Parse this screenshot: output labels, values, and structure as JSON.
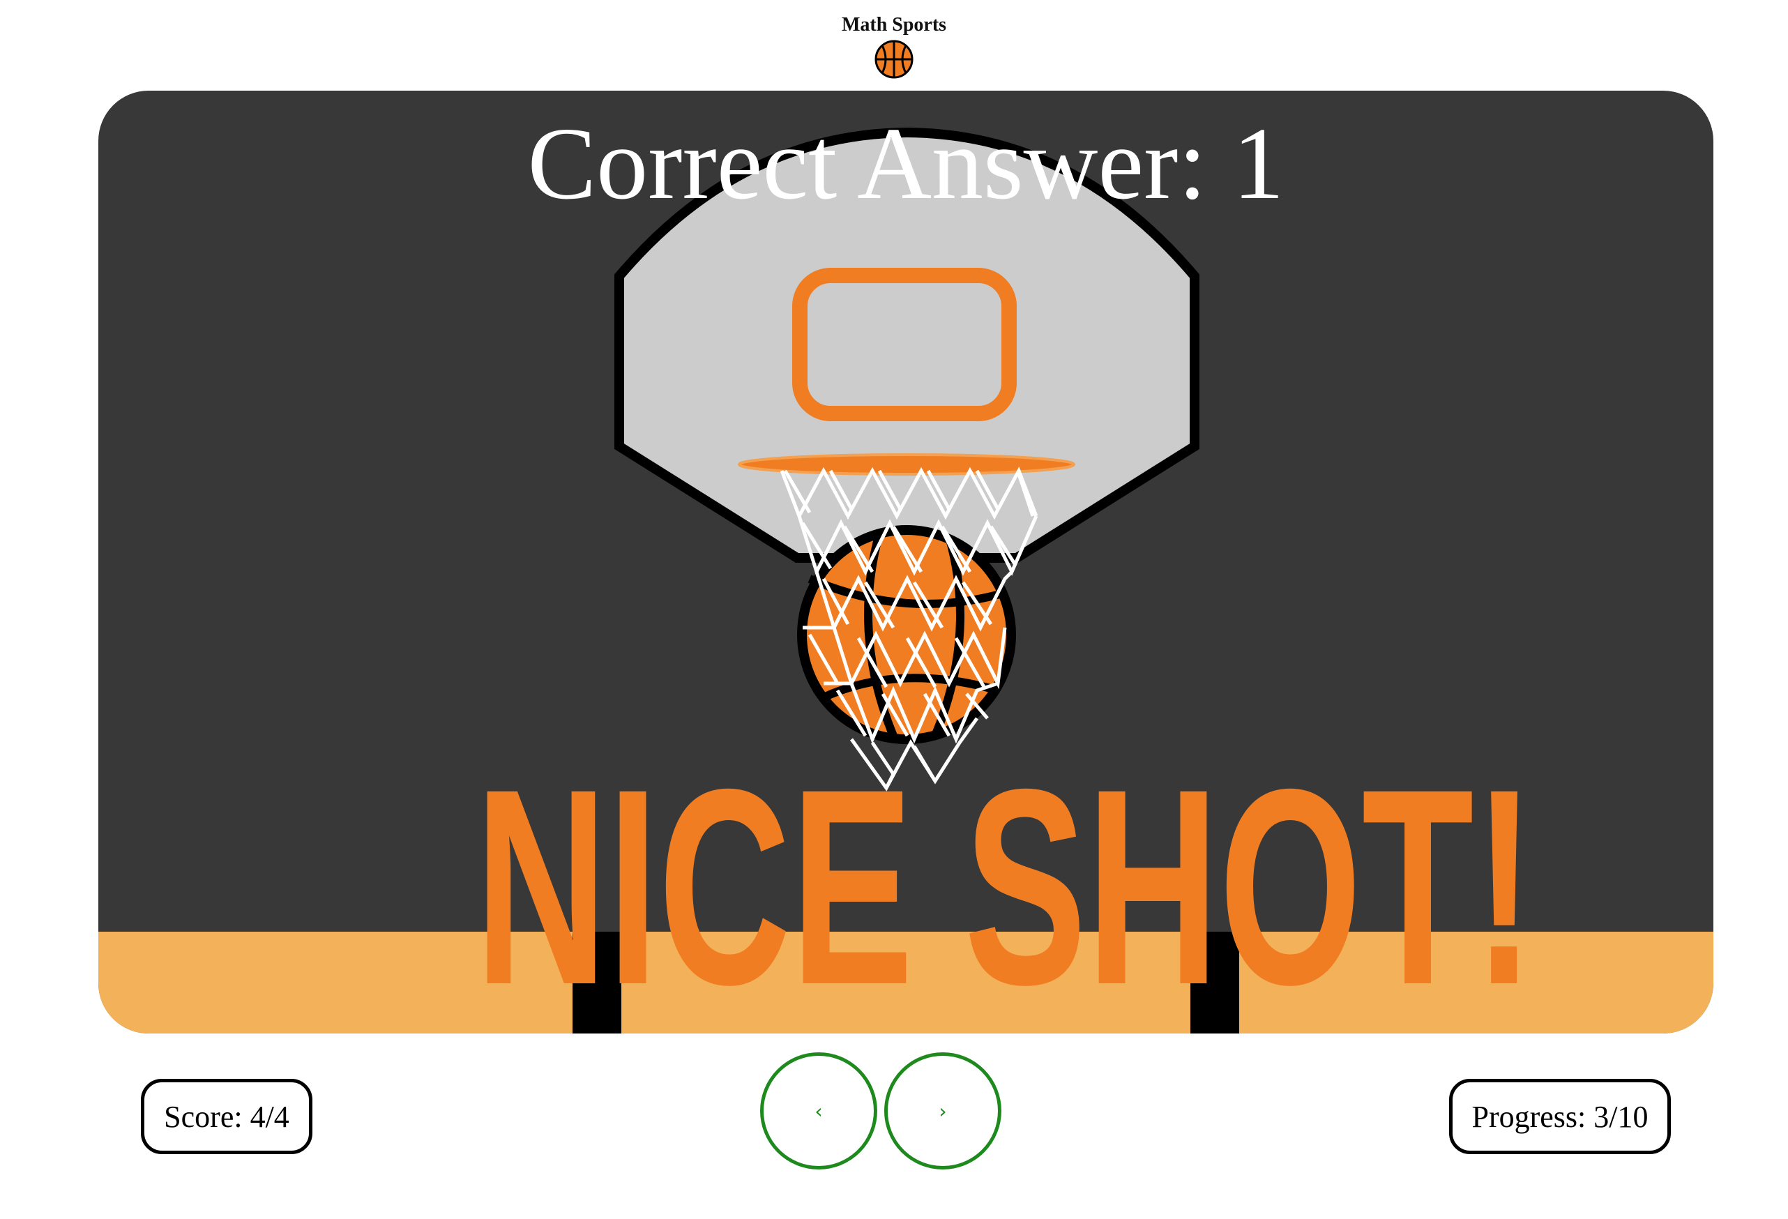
{
  "header": {
    "title": "Math Sports",
    "logo_icon": "basketball-icon"
  },
  "feedback": {
    "answer_text": "Correct Answer: 1",
    "banner_text": "NICE SHOT!"
  },
  "controls": {
    "score_text": "Score: 4/4",
    "progress_text": "Progress: 3/10",
    "prev_label": "‹",
    "next_label": "›",
    "prev_icon": "chevron-left-icon",
    "next_icon": "chevron-right-icon"
  },
  "colors": {
    "court": "#383838",
    "floor": "#f3b25a",
    "orange": "#f07d22",
    "backboard": "#cccccc",
    "nav_accent": "#1e8a1e"
  }
}
